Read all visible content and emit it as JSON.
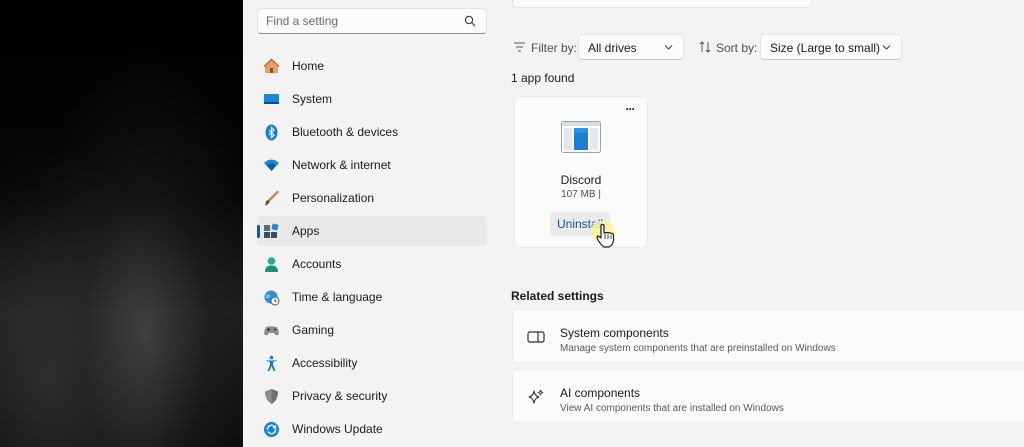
{
  "search": {
    "placeholder": "Find a setting"
  },
  "sidebar": {
    "items": [
      {
        "label": "Home",
        "icon": "home-icon"
      },
      {
        "label": "System",
        "icon": "system-icon"
      },
      {
        "label": "Bluetooth & devices",
        "icon": "bluetooth-icon"
      },
      {
        "label": "Network & internet",
        "icon": "wifi-icon"
      },
      {
        "label": "Personalization",
        "icon": "brush-icon"
      },
      {
        "label": "Apps",
        "icon": "apps-icon",
        "active": true
      },
      {
        "label": "Accounts",
        "icon": "accounts-icon"
      },
      {
        "label": "Time & language",
        "icon": "globe-clock-icon"
      },
      {
        "label": "Gaming",
        "icon": "gamepad-icon"
      },
      {
        "label": "Accessibility",
        "icon": "accessibility-icon"
      },
      {
        "label": "Privacy & security",
        "icon": "shield-icon"
      },
      {
        "label": "Windows Update",
        "icon": "update-icon"
      }
    ]
  },
  "filters": {
    "filter_label": "Filter by:",
    "filter_value": "All drives",
    "sort_label": "Sort by:",
    "sort_value": "Size (Large to small)"
  },
  "results": {
    "count_text": "1 app found"
  },
  "app": {
    "name": "Discord",
    "size": "107 MB |",
    "more_label": "···",
    "uninstall_label": "Uninstall"
  },
  "related": {
    "title": "Related settings",
    "items": [
      {
        "title": "System components",
        "description": "Manage system components that are preinstalled on Windows",
        "icon": "system-components-icon"
      },
      {
        "title": "AI components",
        "description": "View AI components that are installed on Windows",
        "icon": "sparkle-icon"
      }
    ]
  },
  "colors": {
    "accent": "#005fb8",
    "highlight": "#fff59a"
  }
}
